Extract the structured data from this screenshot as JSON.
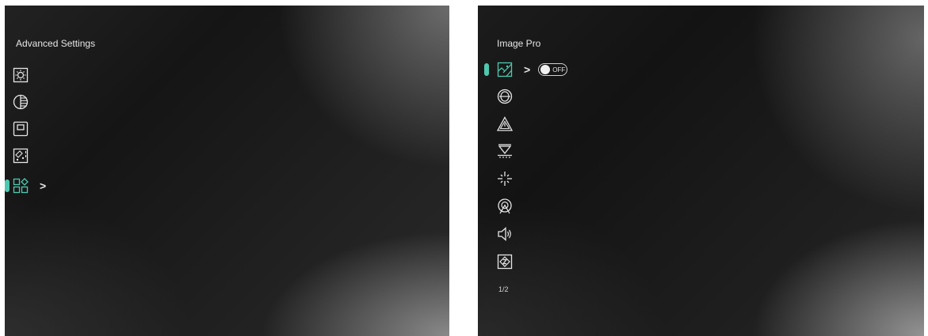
{
  "left_panel": {
    "title": "Advanced Settings",
    "items": [
      {
        "icon": "brightness-icon"
      },
      {
        "icon": "contrast-icon"
      },
      {
        "icon": "scene-mode-icon"
      },
      {
        "icon": "display-effect-icon"
      },
      {
        "icon": "function-settings-icon",
        "selected": true,
        "chevron": ">"
      }
    ]
  },
  "right_panel": {
    "title": "Image Pro",
    "items": [
      {
        "icon": "image-pro-icon",
        "selected": true,
        "chevron": ">",
        "toggle": {
          "state": "OFF"
        }
      },
      {
        "icon": "calibration-icon"
      },
      {
        "icon": "warning-icon"
      },
      {
        "icon": "hot-tracking-icon"
      },
      {
        "icon": "crosshair-icon"
      },
      {
        "icon": "hotspot-tracking-icon"
      },
      {
        "icon": "audio-icon"
      },
      {
        "icon": "zoom-icon"
      }
    ],
    "page_indicator": "1/2"
  },
  "colors": {
    "accent": "#4ec9b0",
    "text": "#e6e6e6"
  }
}
